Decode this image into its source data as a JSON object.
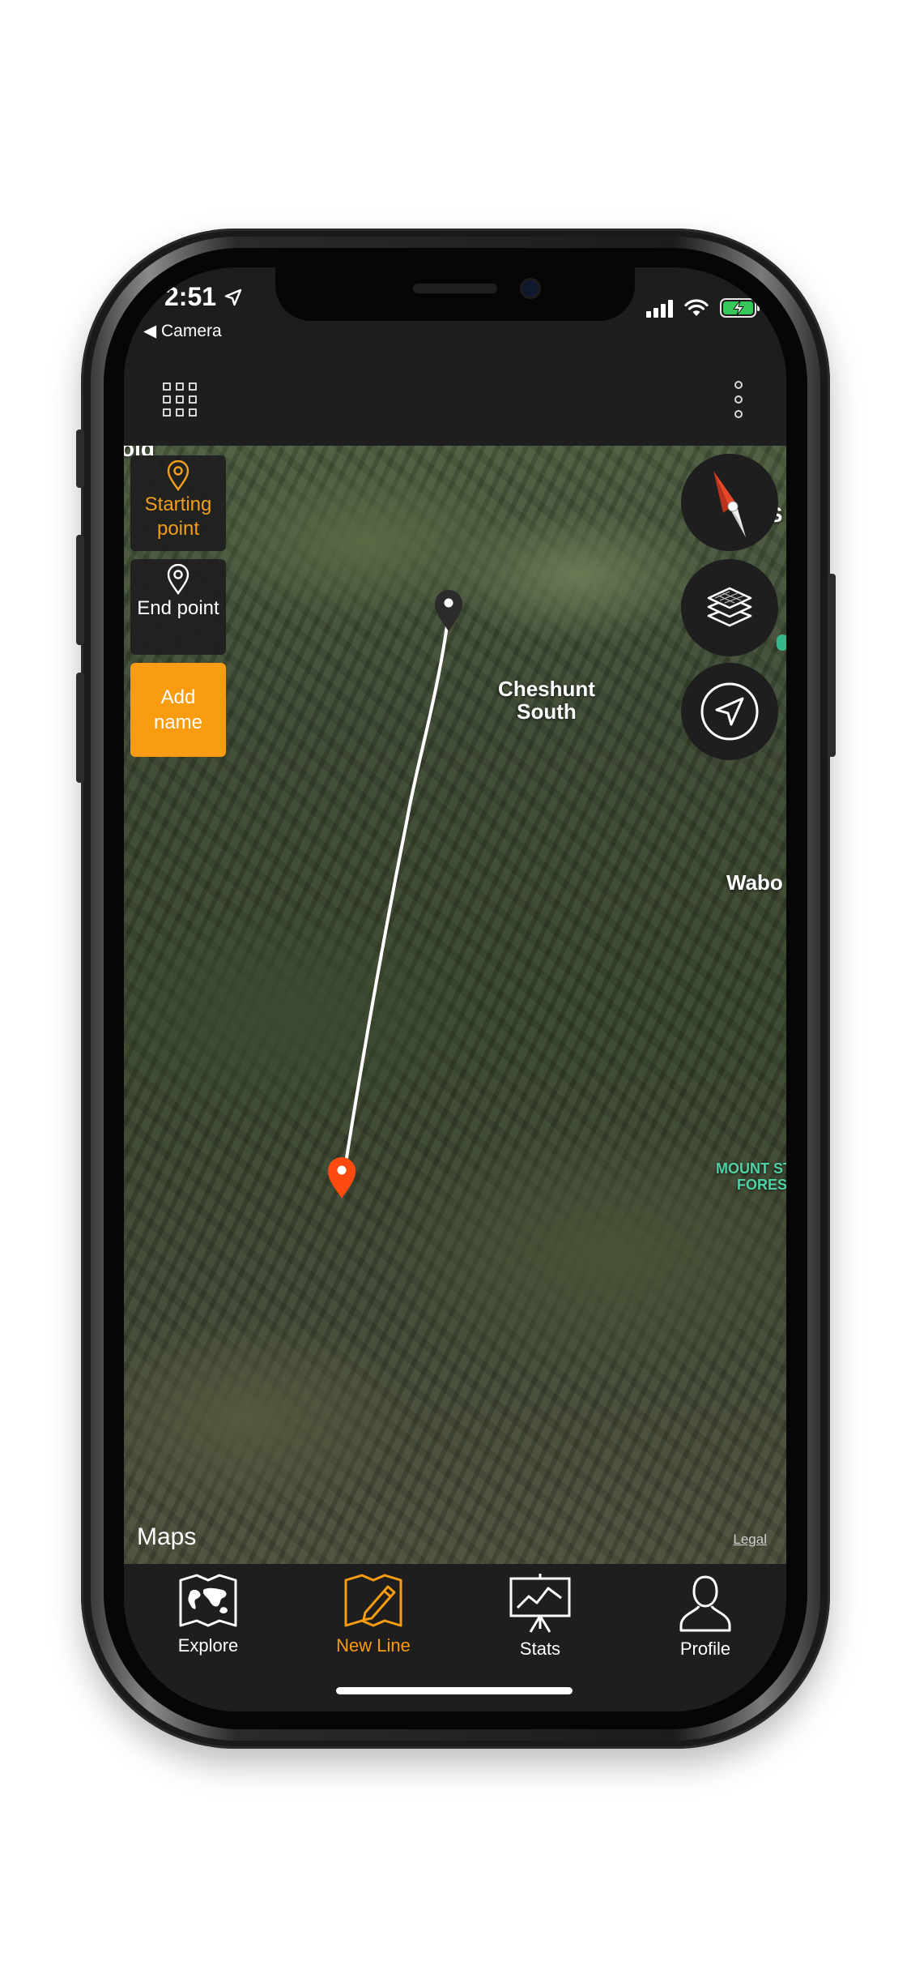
{
  "status_bar": {
    "time": "2:51",
    "back_label": "◀ Camera"
  },
  "map": {
    "labels": {
      "place_1": "Cheshunt South",
      "place_2": "Wabo",
      "place_top_left": "old",
      "place_top_right": "S",
      "forest_line1": "MOUNT STI",
      "forest_line2": "FOREST"
    },
    "attribution": " Maps",
    "legal": "Legal",
    "start_pin_color": "#2b2b2b",
    "end_pin_color": "#ff4a10"
  },
  "tools": {
    "starting_point": "Starting point",
    "end_point": "End point",
    "add_name": "Add name"
  },
  "tabs": [
    {
      "label": "Explore",
      "icon": "map-icon"
    },
    {
      "label": "New Line",
      "icon": "edit-map-icon",
      "active": true
    },
    {
      "label": "Stats",
      "icon": "stats-icon"
    },
    {
      "label": "Profile",
      "icon": "profile-icon"
    }
  ],
  "colors": {
    "accent": "#f99c10",
    "bar": "#1e1e1e"
  }
}
